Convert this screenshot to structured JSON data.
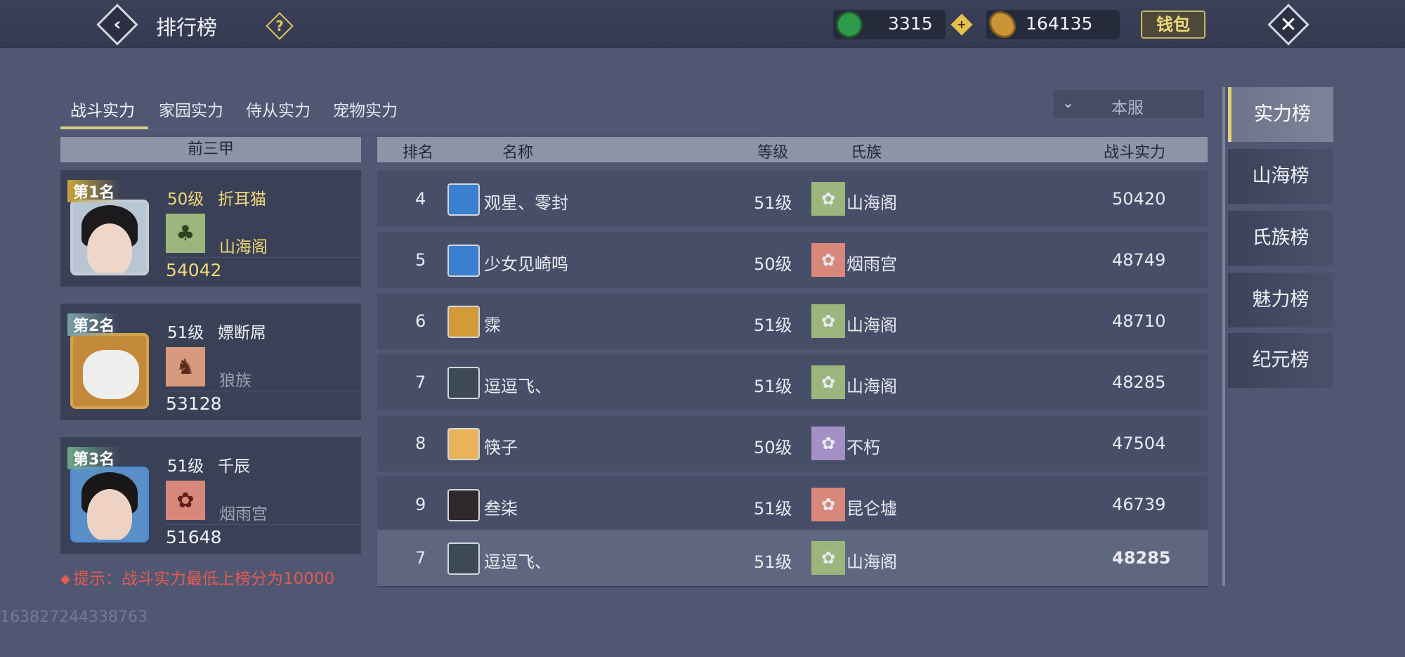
{
  "header": {
    "title": "排行榜",
    "help_icon": "?",
    "jade_amount": "3315",
    "coin_amount": "164135",
    "wallet_label": "钱包"
  },
  "tabs": [
    {
      "label": "战斗实力",
      "active": true
    },
    {
      "label": "家园实力",
      "active": false
    },
    {
      "label": "侍从实力",
      "active": false
    },
    {
      "label": "宠物实力",
      "active": false
    }
  ],
  "server_select": {
    "value": "本服"
  },
  "top3": {
    "header": "前三甲",
    "entries": [
      {
        "rank_label": "第1名",
        "level": "50级",
        "name": "折耳猫",
        "clan": "山海阁",
        "power": "54042",
        "clan_color": "#9bb57c"
      },
      {
        "rank_label": "第2名",
        "level": "51级",
        "name": "嫖断屌",
        "clan": "狼族",
        "power": "53128",
        "clan_color": "#d89a7c"
      },
      {
        "rank_label": "第3名",
        "level": "51级",
        "name": "千辰",
        "clan": "烟雨宫",
        "power": "51648",
        "clan_color": "#d8887a"
      }
    ],
    "tip": "提示：战斗实力最低上榜分为10000"
  },
  "table": {
    "headers": {
      "rank": "排名",
      "name": "名称",
      "level": "等级",
      "clan": "氏族",
      "power": "战斗实力"
    },
    "rows": [
      {
        "rank": "4",
        "name": "观星、零封",
        "level": "51级",
        "clan": "山海阁",
        "power": "50420",
        "clan_color": "#9bb57c",
        "avatar_color": "#3b7fd0"
      },
      {
        "rank": "5",
        "name": "少女见崎鸣",
        "level": "50级",
        "clan": "烟雨宫",
        "power": "48749",
        "clan_color": "#d8887a",
        "avatar_color": "#3b7fd0"
      },
      {
        "rank": "6",
        "name": "霂",
        "level": "51级",
        "clan": "山海阁",
        "power": "48710",
        "clan_color": "#9bb57c",
        "avatar_color": "#d39a3a"
      },
      {
        "rank": "7",
        "name": "逗逗飞、",
        "level": "51级",
        "clan": "山海阁",
        "power": "48285",
        "clan_color": "#9bb57c",
        "avatar_color": "#3d4a55"
      },
      {
        "rank": "8",
        "name": "筷子",
        "level": "50级",
        "clan": "不朽",
        "power": "47504",
        "clan_color": "#a48fc6",
        "avatar_color": "#e8b35a"
      },
      {
        "rank": "9",
        "name": "叁柒",
        "level": "51级",
        "clan": "昆仑墟",
        "power": "46739",
        "clan_color": "#d8887a",
        "avatar_color": "#2e2a2c"
      },
      {
        "rank": "7",
        "name": "逗逗飞、",
        "level": "51级",
        "clan": "山海阁",
        "power": "48285",
        "clan_color": "#9bb57c",
        "avatar_color": "#3d4a55",
        "highlight": true
      }
    ]
  },
  "side_tabs": [
    {
      "label": "实力榜",
      "active": true
    },
    {
      "label": "山海榜",
      "active": false
    },
    {
      "label": "氏族榜",
      "active": false
    },
    {
      "label": "魅力榜",
      "active": false
    },
    {
      "label": "纪元榜",
      "active": false
    }
  ],
  "uid": "163827244338763",
  "colors": {
    "gold": "#f1d878",
    "tip_red": "#e25b4f",
    "accent": "#dccb84"
  }
}
